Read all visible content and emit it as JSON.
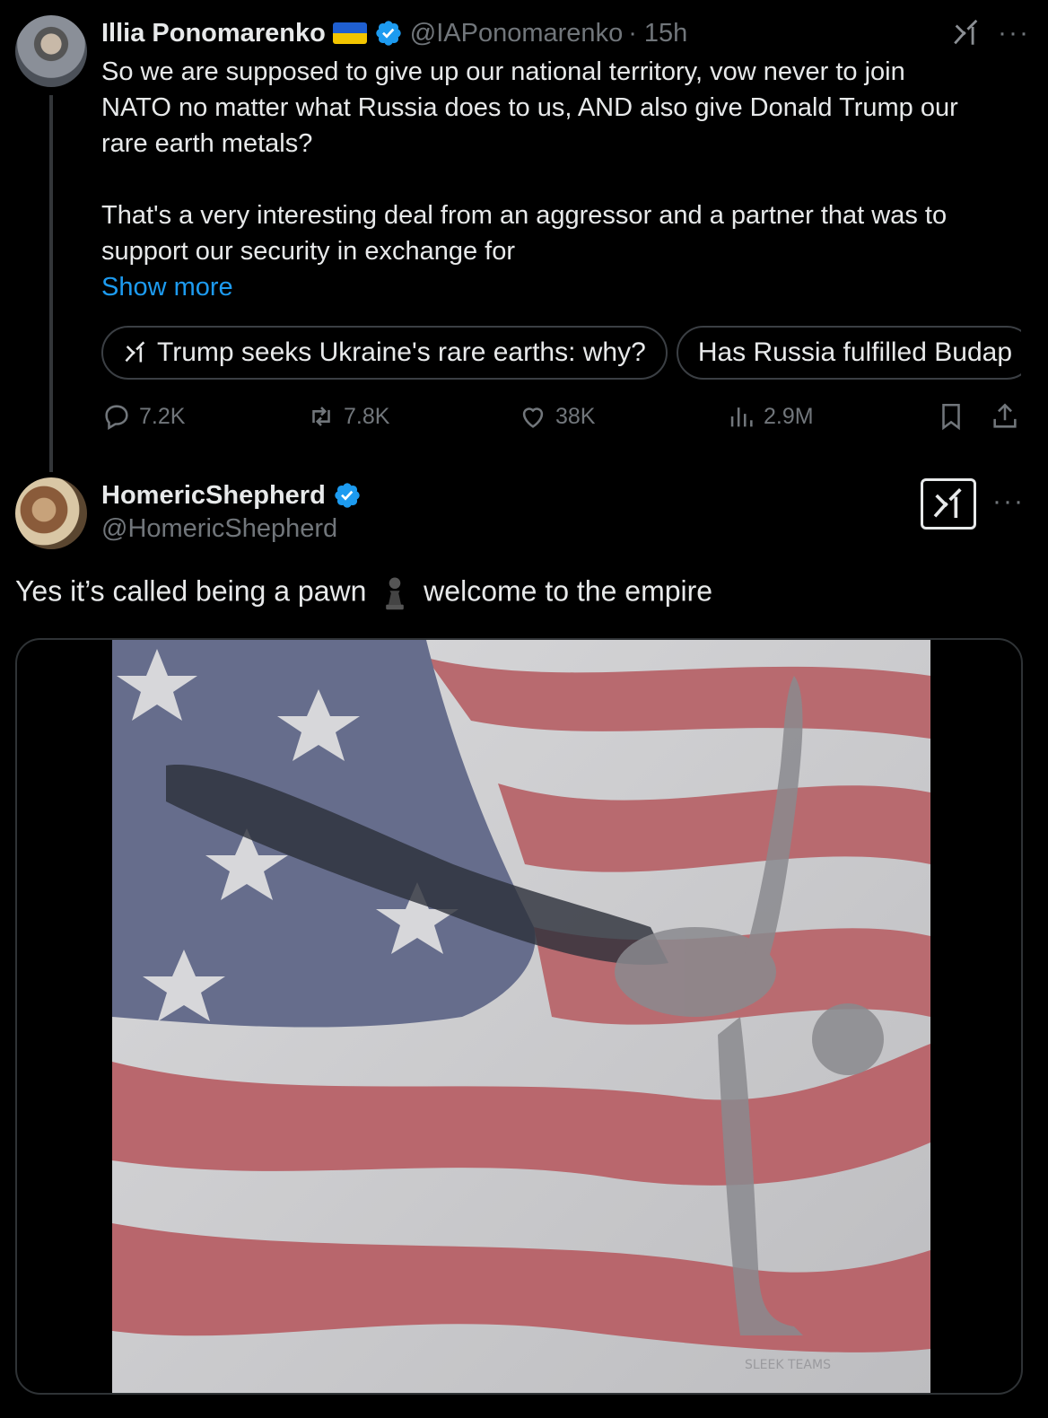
{
  "tweet1": {
    "name": "Illia Ponomarenko",
    "handle": "@IAPonomarenko",
    "time": "· 15h",
    "text": {
      "p1_l1": "So we are supposed to give up our national territory, vow never to join",
      "p1_l2": "NATO no matter what Russia does to us, AND also give Donald Trump our",
      "p1_l3": "rare earth metals?",
      "p2_l1": "That's a very interesting deal from an aggressor and a partner that was to",
      "p2_l2": "support our security in exchange for"
    },
    "show_more": "Show more",
    "chips": [
      "Trump seeks Ukraine's rare earths: why?",
      "Has Russia fulfilled Budap"
    ],
    "stats": {
      "replies": "7.2K",
      "reposts": "7.8K",
      "likes": "38K",
      "views": "2.9M"
    }
  },
  "tweet2": {
    "name": "HomericShepherd",
    "handle": "@HomericShepherd",
    "text_before": "Yes it’s called being a pawn",
    "text_after": "welcome to the empire",
    "image_watermark": "SLEEK TEAMS"
  },
  "colors": {
    "background": "#000000",
    "text": "#e7e9ea",
    "muted": "#71767b",
    "link": "#1d9bf0",
    "verified": "#1d9bf0"
  },
  "icons": [
    "verified-icon",
    "grok-icon",
    "more-icon",
    "reply-icon",
    "repost-icon",
    "like-icon",
    "views-icon",
    "bookmark-icon",
    "share-icon",
    "pawn-icon"
  ]
}
